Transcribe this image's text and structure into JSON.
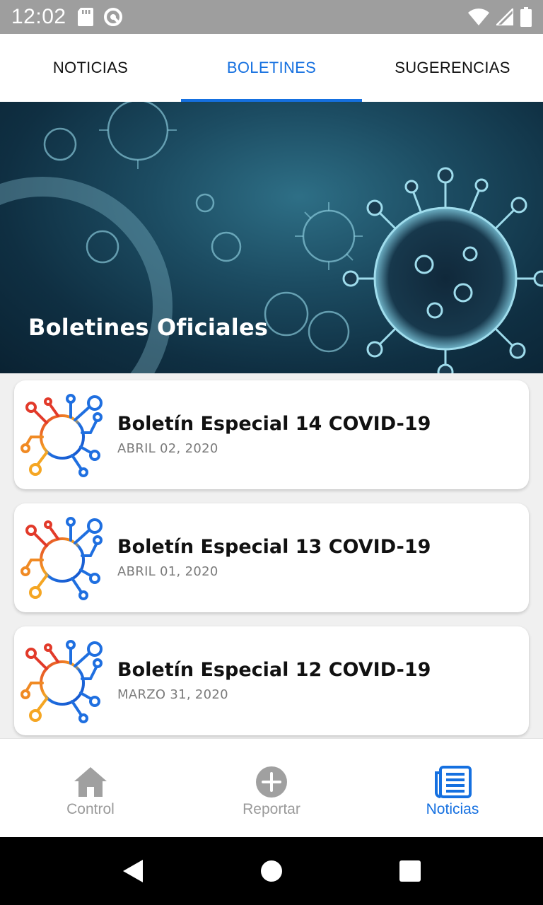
{
  "status_bar": {
    "time": "12:02",
    "left_icons": [
      "sd-card-icon",
      "sync-icon"
    ],
    "right_icons": [
      "wifi-icon",
      "signal-icon",
      "battery-icon"
    ]
  },
  "top_tabs": [
    {
      "label": "NOTICIAS",
      "active": false
    },
    {
      "label": "BOLETINES",
      "active": true
    },
    {
      "label": "SUGERENCIAS",
      "active": false
    }
  ],
  "hero": {
    "title": "Boletines Oficiales"
  },
  "bulletins": [
    {
      "title": "Boletín Especial 14 COVID-19",
      "date": "ABRIL 02, 2020",
      "icon": "virus-logo-icon"
    },
    {
      "title": "Boletín Especial 13 COVID-19",
      "date": "ABRIL 01, 2020",
      "icon": "virus-logo-icon"
    },
    {
      "title": "Boletín Especial 12 COVID-19",
      "date": "MARZO 31, 2020",
      "icon": "virus-logo-icon"
    }
  ],
  "bottom_nav": [
    {
      "label": "Control",
      "icon": "home-icon",
      "active": false
    },
    {
      "label": "Reportar",
      "icon": "add-circle-icon",
      "active": false
    },
    {
      "label": "Noticias",
      "icon": "newspaper-icon",
      "active": true
    }
  ],
  "system_nav": [
    "back-icon",
    "home-circle-icon",
    "recents-icon"
  ],
  "colors": {
    "accent": "#1570e0",
    "status_bar": "#9e9e9e",
    "inactive": "#9a9a9a"
  }
}
